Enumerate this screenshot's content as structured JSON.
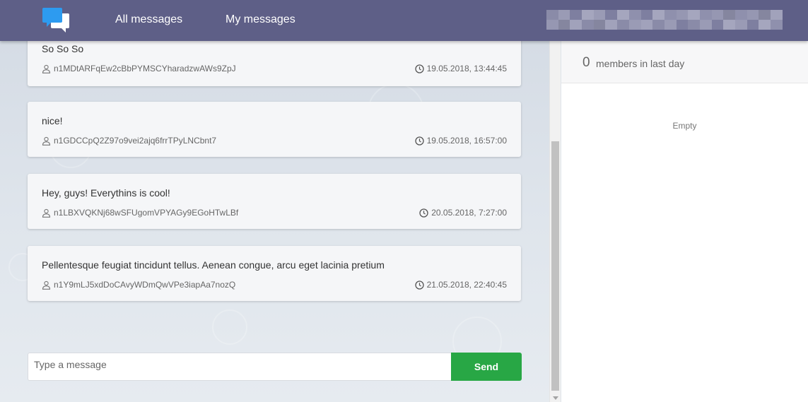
{
  "header": {
    "nav_all": "All messages",
    "nav_my": "My messages",
    "accent": "#5e5f87"
  },
  "messages": [
    {
      "text": "So So So",
      "author": "n1MDtARFqEw2cBbPYMSCYharadzwAWs9ZpJ",
      "time": "19.05.2018, 13:44:45"
    },
    {
      "text": "nice!",
      "author": "n1GDCCpQ2Z97o9vei2ajq6frrTPyLNCbnt7",
      "time": "19.05.2018, 16:57:00"
    },
    {
      "text": "Hey, guys! Everythins is cool!",
      "author": "n1LBXVQKNj68wSFUgomVPYAGy9EGoHTwLBf",
      "time": "20.05.2018, 7:27:00"
    },
    {
      "text": "Pellentesque feugiat tincidunt tellus. Aenean congue, arcu eget lacinia pretium",
      "author": "n1Y9mLJ5xdDoCAvyWDmQwVPe3iapAa7nozQ",
      "time": "21.05.2018, 22:40:45"
    }
  ],
  "composer": {
    "placeholder": "Type a message",
    "send_label": "Send",
    "send_color": "#28a745"
  },
  "sidebar": {
    "members_count": "0",
    "members_label": "members in last day",
    "empty_text": "Empty"
  },
  "icons": {
    "logo": "chat-bubbles-icon",
    "author": "user-icon",
    "time": "clock-icon"
  }
}
